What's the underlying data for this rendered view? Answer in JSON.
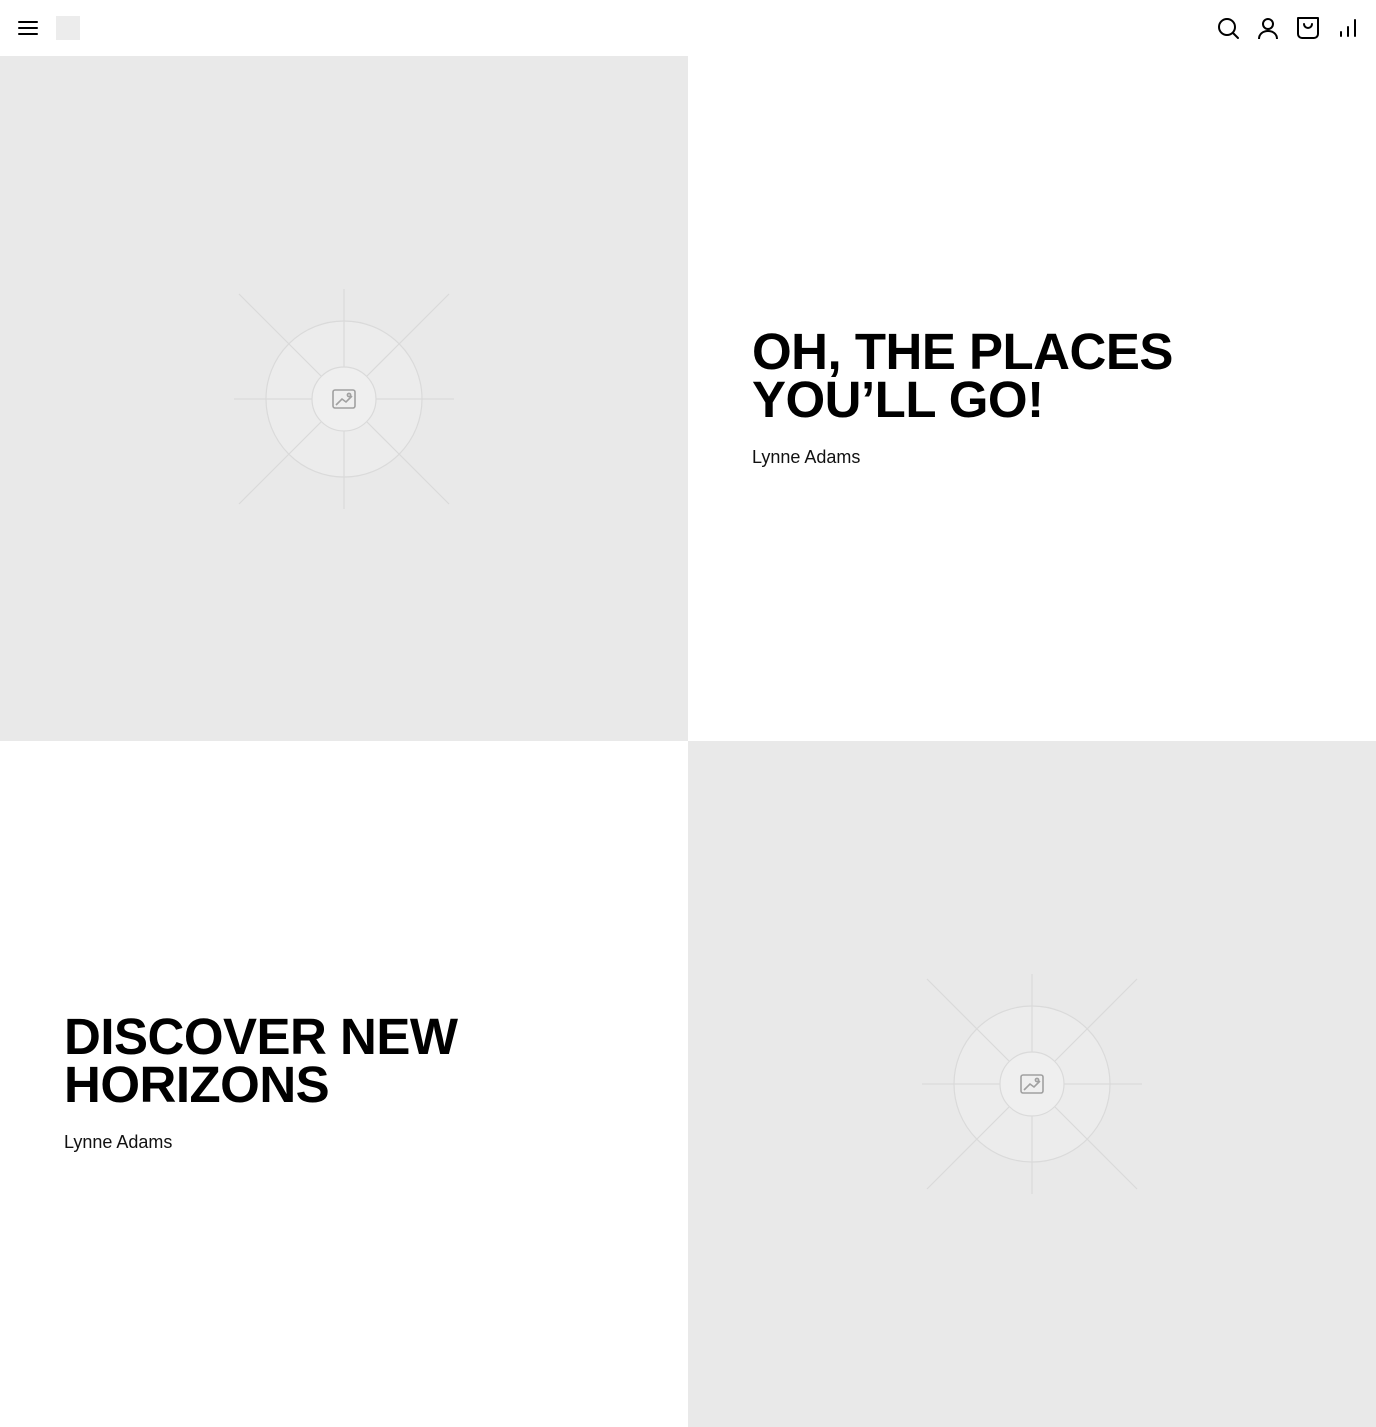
{
  "header": {
    "menu_icon": "hamburger-menu-icon",
    "logo": "logo",
    "search_icon": "search-icon",
    "account_icon": "user-account-icon",
    "cart_icon": "shopping-bag-icon",
    "stats_icon": "bar-chart-icon"
  },
  "tiles": [
    {
      "image_icon": "image-placeholder-icon",
      "heading": "OH, THE PLACES YOU’LL GO!",
      "author": "Lynne Adams"
    },
    {
      "image_icon": "image-placeholder-icon",
      "heading": "DISCOVER NEW HORIZONS",
      "author": "Lynne Adams"
    }
  ],
  "colors": {
    "background": "#ffffff",
    "placeholder_bg": "#e9e9e9",
    "text": "#000000"
  }
}
